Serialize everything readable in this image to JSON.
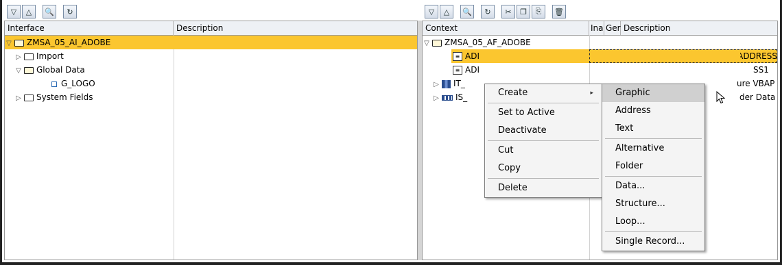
{
  "left": {
    "headers": {
      "interface": "Interface",
      "description": "Description"
    },
    "tree": [
      {
        "label": "ZMSA_05_AI_ADOBE"
      },
      {
        "label": "Import"
      },
      {
        "label": "Global Data"
      },
      {
        "label": "G_LOGO"
      },
      {
        "label": "System Fields"
      }
    ]
  },
  "right": {
    "headers": {
      "context": "Context",
      "inactive": "Ina",
      "german": "Ger",
      "description": "Description"
    },
    "tree": [
      {
        "label": "ZMSA_05_AF_ADOBE",
        "desc": ""
      },
      {
        "label": "ADI",
        "desc": "Address Node ADDRESS"
      },
      {
        "label": "ADI",
        "desc": "SS1"
      },
      {
        "label": "IT_",
        "desc": "ure VBAP"
      },
      {
        "label": "IS_",
        "desc": "der Data"
      }
    ]
  },
  "context_menu": {
    "items": [
      "Create",
      "Set to Active",
      "Deactivate",
      "Cut",
      "Copy",
      "Delete"
    ]
  },
  "submenu": {
    "items": [
      "Graphic",
      "Address",
      "Text",
      "Alternative",
      "Folder",
      "Data...",
      "Structure...",
      "Loop...",
      "Single Record..."
    ]
  },
  "colors": {
    "selection": "#fbc62f",
    "menu_bg": "#f4f4f4",
    "menu_highlight": "#d0d0d0"
  },
  "icons": {
    "left_toolbar": [
      "expand-all-icon",
      "collapse-all-icon",
      "find-icon",
      "refresh-icon"
    ],
    "right_toolbar": [
      "expand-all-icon",
      "collapse-all-icon",
      "find-icon",
      "refresh-icon",
      "cut-icon",
      "copy-icon",
      "paste-icon",
      "delete-icon"
    ]
  }
}
